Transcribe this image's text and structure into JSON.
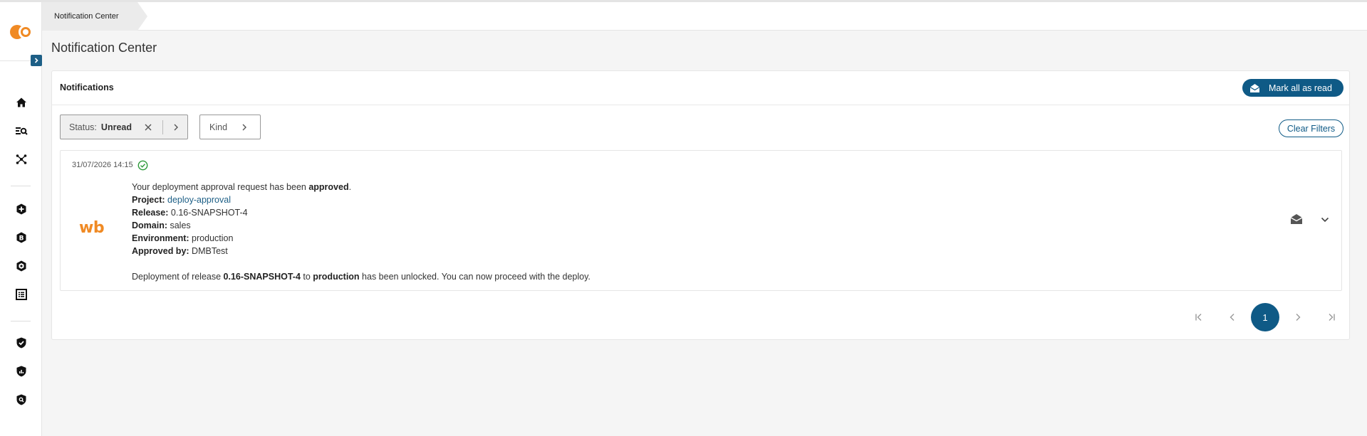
{
  "breadcrumb": {
    "label": "Notification Center"
  },
  "page": {
    "title": "Notification Center"
  },
  "card": {
    "title": "Notifications",
    "mark_all_label": "Mark all as read",
    "clear_filters_label": "Clear Filters"
  },
  "filters": {
    "status_label": "Status:",
    "status_value": "Unread",
    "kind_label": "Kind"
  },
  "notification": {
    "timestamp": "31/07/2026 14:15",
    "sender_logo": "wb",
    "intro_prefix": "Your deployment approval request has been ",
    "intro_bold": "approved",
    "intro_suffix": ".",
    "project_key": "Project:",
    "project_value": "deploy-approval",
    "release_key": "Release:",
    "release_value": "0.16-SNAPSHOT-4",
    "domain_key": "Domain:",
    "domain_value": "sales",
    "environment_key": "Environment:",
    "environment_value": "production",
    "approved_by_key": "Approved by:",
    "approved_by_value": "DMBTest",
    "footer_prefix": "Deployment of release ",
    "footer_release": "0.16-SNAPSHOT-4",
    "footer_mid": " to ",
    "footer_env": "production",
    "footer_suffix": " has been unlocked. You can now proceed with the deploy."
  },
  "pagination": {
    "current_page": "1"
  },
  "colors": {
    "primary": "#0f5a86",
    "brand_orange": "#f08a24",
    "success": "#2e9a3a"
  }
}
